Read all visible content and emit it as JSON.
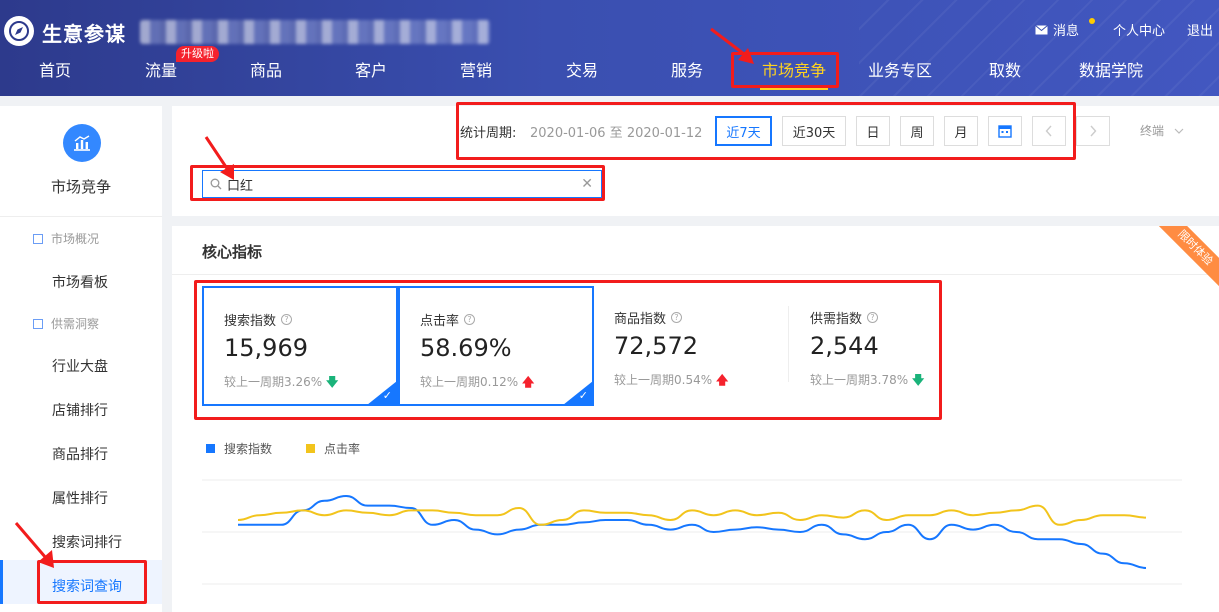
{
  "header": {
    "brand": "生意参谋",
    "messages": "消息",
    "personal_center": "个人中心",
    "logout": "退出"
  },
  "nav": {
    "items": [
      "首页",
      "流量",
      "商品",
      "客户",
      "营销",
      "交易",
      "服务",
      "市场竞争",
      "业务专区",
      "取数",
      "数据学院"
    ],
    "badge": "升级啦",
    "active": "市场竞争"
  },
  "sidebar": {
    "title": "市场竞争",
    "group1": "市场概况",
    "item1": "市场看板",
    "group2": "供需洞察",
    "items": [
      "行业大盘",
      "店铺排行",
      "商品排行",
      "属性排行",
      "搜索词排行",
      "搜索词查询"
    ],
    "active": "搜索词查询"
  },
  "filter": {
    "period_label": "统计周期:",
    "period_range": "2020-01-06 至 2020-01-12",
    "buttons": [
      "近7天",
      "近30天",
      "日",
      "周",
      "月"
    ],
    "active": "近7天",
    "terminal": "终端",
    "search_value": "口红"
  },
  "core": {
    "title": "核心指标",
    "ribbon": "限时体验",
    "metrics": [
      {
        "name": "搜索指数",
        "value": "15,969",
        "compare": "较上一周期3.26%",
        "trend": "down",
        "selected": true
      },
      {
        "name": "点击率",
        "value": "58.69%",
        "compare": "较上一周期0.12%",
        "trend": "up",
        "selected": true
      },
      {
        "name": "商品指数",
        "value": "72,572",
        "compare": "较上一周期0.54%",
        "trend": "up",
        "selected": false
      },
      {
        "name": "供需指数",
        "value": "2,544",
        "compare": "较上一周期3.78%",
        "trend": "down",
        "selected": false
      }
    ]
  },
  "colors": {
    "accent": "#1677ff",
    "series_search": "#1677ff",
    "series_ctr": "#f2c41c",
    "annotation": "#f21c1c"
  },
  "chart_data": {
    "type": "line",
    "series": [
      {
        "name": "搜索指数",
        "values": [
          58,
          58,
          58,
          64,
          68,
          70,
          66,
          66,
          65,
          58,
          60,
          56,
          54,
          56,
          58,
          58,
          59,
          60,
          60,
          58,
          56,
          58,
          55,
          56,
          57,
          56,
          55,
          58,
          54,
          52,
          55,
          58,
          52,
          58,
          56,
          58,
          55,
          52,
          52,
          50,
          46,
          42,
          40
        ]
      },
      {
        "name": "点击率",
        "values": [
          60,
          62,
          63,
          64,
          62,
          64,
          63,
          62,
          64,
          64,
          63,
          62,
          62,
          65,
          58,
          60,
          64,
          63,
          63,
          62,
          60,
          64,
          62,
          64,
          62,
          63,
          60,
          62,
          61,
          64,
          60,
          62,
          62,
          64,
          62,
          63,
          64,
          66,
          58,
          60,
          62,
          62,
          61
        ]
      }
    ],
    "legend": "top-left",
    "grid": true
  }
}
